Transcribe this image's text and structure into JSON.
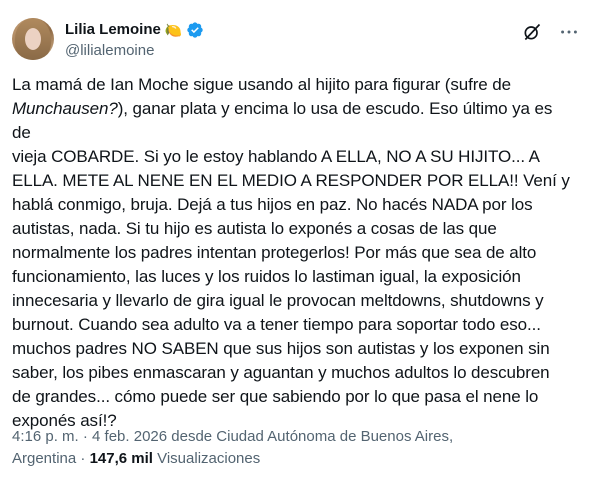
{
  "author": {
    "display_name": "Lilia Lemoine",
    "emoji": "🍋",
    "handle": "@lilialemoine"
  },
  "icons": {
    "verified": "verified-badge-icon",
    "grok": "grok-icon",
    "more": "more-options-icon"
  },
  "colors": {
    "verified": "#1d9bf0",
    "text": "#0f1419",
    "secondary": "#536471"
  },
  "tweet": {
    "lines": [
      [
        "La mamá de Ian Moche sigue usando al hijito para figurar (sufre de"
      ],
      [
        "Munchausen?",
        "), ganar plata y encima lo usa de escudo.  Eso último ya es de"
      ],
      [
        "vieja COBARDE. Si yo le estoy hablando A ELLA, NO A SU HIJITO... A"
      ],
      [
        "ELLA. METE AL NENE EN EL MEDIO A RESPONDER POR ELLA!! Vení y"
      ],
      [
        "hablá conmigo, bruja. Dejá a tus hijos en paz. No hacés NADA por los"
      ],
      [
        "autistas, nada. Si tu hijo es autista lo exponés a cosas de las que"
      ],
      [
        "normalmente los padres intentan protegerlos! Por más que sea de alto"
      ],
      [
        "funcionamiento, las luces y los ruidos lo lastiman igual, la exposición"
      ],
      [
        "innecesaria y llevarlo de gira igual le provocan meltdowns, shutdowns y"
      ],
      [
        "burnout.  Cuando sea adulto va a tener tiempo para soportar todo eso..."
      ],
      [
        "muchos padres NO SABEN que sus hijos son autistas y los exponen sin"
      ],
      [
        "saber, los pibes enmascaran y aguantan y muchos adultos lo descubren"
      ],
      [
        "de grandes... cómo puede ser que sabiendo por lo que pasa el nene lo"
      ],
      [
        "exponés así!?"
      ]
    ],
    "line2_prefix": "(sufre de",
    "italic_word": "Munchausen?",
    "line2_rest": "), ganar plata y encima lo usa de escudo.  Eso último ya es de"
  },
  "meta": {
    "line1": "4:16 p. m. · 4 feb. 2026 desde Ciudad Autónoma de Buenos Aires,",
    "location_cont": "Argentina",
    "separator": " · ",
    "views_count": "147,6 mil",
    "views_label": " Visualizaciones"
  }
}
